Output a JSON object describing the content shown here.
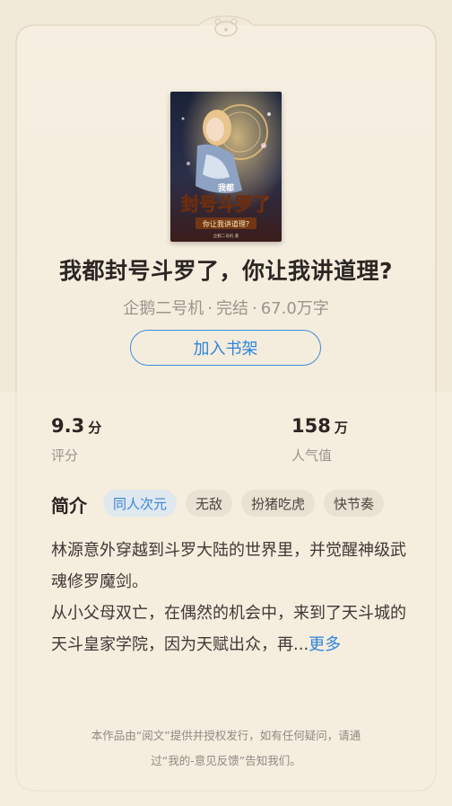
{
  "cover": {
    "title_small": "我都",
    "title_main": "封号斗罗了",
    "title_sub": "你让我讲道理?",
    "credit": "企鹅二号机 著"
  },
  "book": {
    "title": "我都封号斗罗了，你让我讲道理?",
    "author": "企鹅二号机",
    "status": "完结",
    "word_count": "67.0万字",
    "separator": "·"
  },
  "actions": {
    "add_to_shelf": "加入书架"
  },
  "stats": {
    "score_value": "9.3",
    "score_unit": "分",
    "score_label": "评分",
    "popularity_value": "158",
    "popularity_unit": "万",
    "popularity_label": "人气值"
  },
  "intro": {
    "heading": "简介",
    "tags": [
      "同人次元",
      "无敌",
      "扮猪吃虎",
      "快节奏"
    ],
    "paragraph1": "林源意外穿越到斗罗大陆的世界里，并觉醒神级武魂修罗魔剑。",
    "paragraph2": "从小父母双亡，在偶然的机会中，来到了天斗城的天斗皇家学院，因为天赋出众，再...",
    "more": "更多"
  },
  "footer": {
    "line1": "本作品由“阅文”提供并授权发行，如有任何疑问，请通",
    "line2": "过“我的-意见反馈”告知我们。"
  },
  "colors": {
    "background": "#f2ead9",
    "accent": "#2f86dd",
    "title_text": "#2b2623",
    "muted_text": "#9a948c"
  }
}
